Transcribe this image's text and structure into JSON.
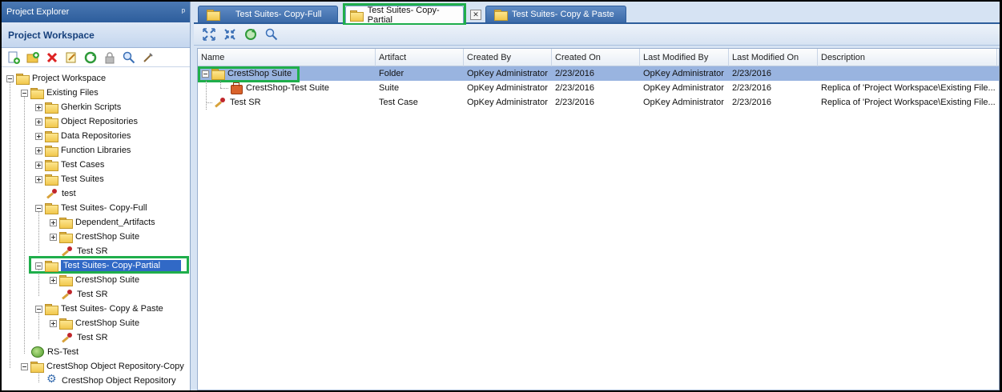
{
  "project_explorer": {
    "title": "Project Explorer",
    "pin_glyph": "ᵖ",
    "workspace_header": "Project Workspace",
    "toolbar": [
      "new-file-icon",
      "new-folder-icon",
      "delete-icon",
      "rename-icon",
      "refresh-icon",
      "lock-icon",
      "search-icon",
      "tools-icon"
    ],
    "tree": {
      "root": "Project Workspace",
      "existing_files": "Existing Files",
      "gherkin": "Gherkin Scripts",
      "object_repos": "Object Repositories",
      "data_repos": "Data Repositories",
      "function_libs": "Function Libraries",
      "test_cases": "Test Cases",
      "test_suites": "Test Suites",
      "test": "test",
      "copy_full": "Test Suites- Copy-Full",
      "dependent": "Dependent_Artifacts",
      "crestshop_suite_1": "CrestShop Suite",
      "test_sr_1": "Test SR",
      "copy_partial": "Test Suites- Copy-Partial",
      "crestshop_suite_2": "CrestShop Suite",
      "test_sr_2": "Test SR",
      "copy_paste": "Test Suites- Copy & Paste",
      "crestshop_suite_3": "CrestShop Suite",
      "test_sr_3": "Test SR",
      "rs_test": "RS-Test",
      "or_copy": "CrestShop Object Repository-Copy",
      "or": "CrestShop Object Repository"
    }
  },
  "tabs": [
    {
      "label": "Test Suites- Copy-Full",
      "active": false
    },
    {
      "label": "Test Suites- Copy-Partial",
      "active": true
    },
    {
      "label": "Test Suites- Copy & Paste",
      "active": false
    }
  ],
  "tab_close_glyph": "✕",
  "right_toolbar": [
    "expand-all-icon",
    "collapse-all-icon",
    "refresh-icon",
    "search-icon"
  ],
  "grid": {
    "columns": [
      "Name",
      "Artifact",
      "Created By",
      "Created On",
      "Last Modified By",
      "Last Modified On",
      "Description"
    ],
    "rows": [
      {
        "name": "CrestShop Suite",
        "artifact": "Folder",
        "created_by": "OpKey Administrator",
        "created_on": "2/23/2016",
        "modified_by": "OpKey Administrator",
        "modified_on": "2/23/2016",
        "description": ""
      },
      {
        "name": "CrestShop-Test Suite",
        "artifact": "Suite",
        "created_by": "OpKey Administrator",
        "created_on": "2/23/2016",
        "modified_by": "OpKey Administrator",
        "modified_on": "2/23/2016",
        "description": "Replica of 'Project Workspace\\Existing File..."
      },
      {
        "name": "Test SR",
        "artifact": "Test Case",
        "created_by": "OpKey Administrator",
        "created_on": "2/23/2016",
        "modified_by": "OpKey Administrator",
        "modified_on": "2/23/2016",
        "description": "Replica of 'Project Workspace\\Existing File..."
      }
    ]
  },
  "colors": {
    "highlight_box": "#1fae4b",
    "selected_row": "#99b4e0",
    "selected_tree": "#3169c6"
  }
}
